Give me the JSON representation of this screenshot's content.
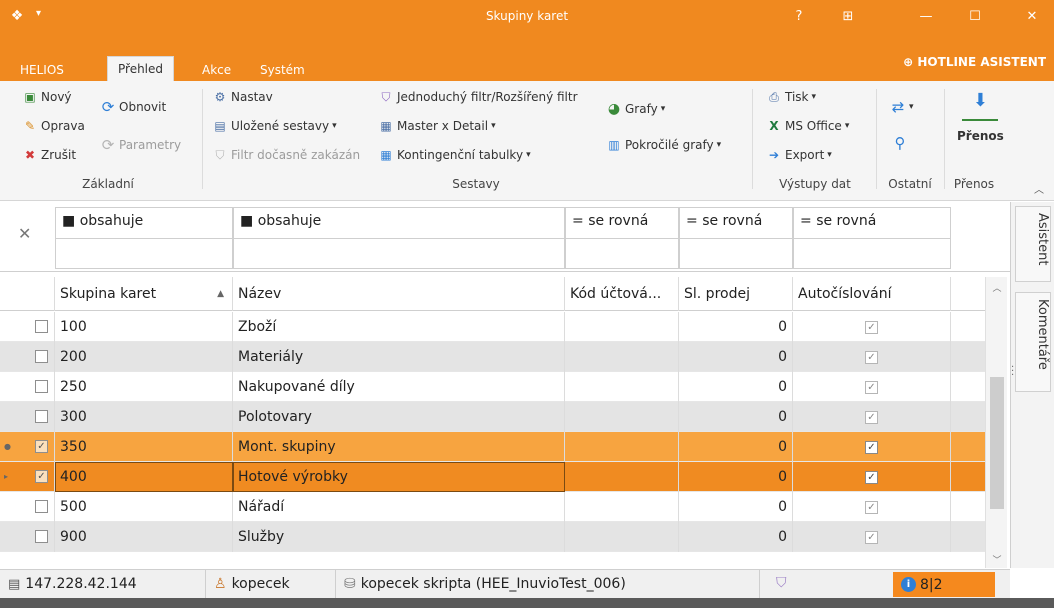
{
  "window": {
    "title": "Skupiny karet",
    "quick_access": "▾",
    "controls": {
      "help": "?",
      "restore_layout": "⊞",
      "minimize": "—",
      "maximize": "☐",
      "close": "✕"
    }
  },
  "ribbon_tabs": [
    {
      "label": "HELIOS"
    },
    {
      "label": "Přehled",
      "active": true
    },
    {
      "label": "Akce"
    },
    {
      "label": "Systém"
    }
  ],
  "hotline": "HOTLINE ASISTENT",
  "ribbon": {
    "zakladni": {
      "label": "Základní",
      "novy": "Nový",
      "oprava": "Oprava",
      "zrusit": "Zrušit",
      "obnovit": "Obnovit",
      "parametry": "Parametry"
    },
    "sestavy": {
      "label": "Sestavy",
      "nastav": "Nastav",
      "ulozene_sestavy": "Uložené sestavy",
      "filtr_docasne": "Filtr dočasně zakázán",
      "jednoduchy_filtr": "Jednoduchý filtr/Rozšířený filtr",
      "master_detail": "Master x Detail",
      "kontingencni": "Kontingenční tabulky",
      "grafy": "Grafy",
      "pokrocile_grafy": "Pokročilé grafy"
    },
    "vystupy": {
      "label": "Výstupy dat",
      "tisk": "Tisk",
      "ms_office": "MS Office",
      "export": "Export"
    },
    "ostatni": {
      "label": "Ostatní"
    },
    "prenos": {
      "label": "Přenos",
      "button": "Přenos"
    }
  },
  "filters": [
    {
      "op": "obsahuje",
      "op_icon": "■"
    },
    {
      "op": "obsahuje",
      "op_icon": "■"
    },
    {
      "op": "se rovná",
      "op_icon": "="
    },
    {
      "op": "se rovná",
      "op_icon": "="
    },
    {
      "op": "se rovná",
      "op_icon": "="
    }
  ],
  "grid": {
    "columns": [
      "Skupina karet",
      "Název",
      "Kód účtová...",
      "Sl. prodej",
      "Autočíslování"
    ],
    "sort_indicator": "▲",
    "rows": [
      {
        "code": "100",
        "name": "Zboží",
        "kod": "",
        "prodej": "0",
        "auto": true,
        "checked": false,
        "state": "odd"
      },
      {
        "code": "200",
        "name": "Materiály",
        "kod": "",
        "prodej": "0",
        "auto": true,
        "checked": false,
        "state": "even"
      },
      {
        "code": "250",
        "name": "Nakupované díly",
        "kod": "",
        "prodej": "0",
        "auto": true,
        "checked": false,
        "state": "odd"
      },
      {
        "code": "300",
        "name": "Polotovary",
        "kod": "",
        "prodej": "0",
        "auto": true,
        "checked": false,
        "state": "even"
      },
      {
        "code": "350",
        "name": "Mont. skupiny",
        "kod": "",
        "prodej": "0",
        "auto": true,
        "checked": true,
        "state": "sel"
      },
      {
        "code": "400",
        "name": "Hotové výrobky",
        "kod": "",
        "prodej": "0",
        "auto": true,
        "checked": true,
        "state": "focus"
      },
      {
        "code": "500",
        "name": "Nářadí",
        "kod": "",
        "prodej": "0",
        "auto": true,
        "checked": false,
        "state": "odd"
      },
      {
        "code": "900",
        "name": "Služby",
        "kod": "",
        "prodej": "0",
        "auto": true,
        "checked": false,
        "state": "even"
      }
    ]
  },
  "side_tabs": [
    "Asistent",
    "Komentáře"
  ],
  "status": {
    "server": "147.228.42.144",
    "user": "kopecek",
    "database": "kopecek skripta (HEE_InuvioTest_006)",
    "counter": "8|2"
  },
  "colors": {
    "accent": "#f0891f",
    "row_selected": "#f7a440",
    "row_focused": "#f08b21"
  }
}
